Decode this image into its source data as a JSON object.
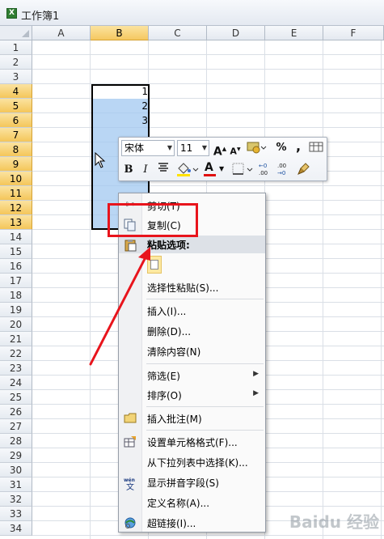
{
  "window": {
    "title": "工作簿1"
  },
  "columns": [
    "A",
    "B",
    "C",
    "D",
    "E",
    "F"
  ],
  "selected_column": "B",
  "rows": [
    "1",
    "2",
    "3",
    "4",
    "5",
    "6",
    "7",
    "8",
    "9",
    "10",
    "11",
    "12",
    "13",
    "14",
    "15",
    "16",
    "17",
    "18",
    "19",
    "20",
    "21",
    "22",
    "23",
    "24",
    "25",
    "26",
    "27",
    "28",
    "29",
    "30",
    "31",
    "32",
    "33",
    "34"
  ],
  "selected_rows": [
    "4",
    "5",
    "6",
    "7",
    "8",
    "9",
    "10",
    "11",
    "12",
    "13"
  ],
  "cells": {
    "B4": "1",
    "B5": "2",
    "B6": "3"
  },
  "mini_toolbar": {
    "font_name": "宋体",
    "font_size": "11",
    "percent_label": "%",
    "comma_label": ",",
    "bold_label": "B",
    "italic_label": "I",
    "font_color_label": "A"
  },
  "context_menu": {
    "cut": "剪切(T)",
    "copy": "复制(C)",
    "paste_options": "粘贴选项:",
    "paste_special": "选择性粘贴(S)...",
    "insert": "插入(I)...",
    "delete": "删除(D)...",
    "clear_contents": "清除内容(N)",
    "filter": "筛选(E)",
    "sort": "排序(O)",
    "insert_comment": "插入批注(M)",
    "format_cells": "设置单元格格式(F)...",
    "pick_from_list": "从下拉列表中选择(K)...",
    "show_phonetic": "显示拼音字段(S)",
    "define_name": "定义名称(A)...",
    "hyperlink": "超链接(I)..."
  },
  "watermark": "Baidu 经验",
  "colors": {
    "annotation_red": "#e8141c",
    "selection_fill": "#a1c8f0",
    "header_selected": "#f5c860"
  }
}
